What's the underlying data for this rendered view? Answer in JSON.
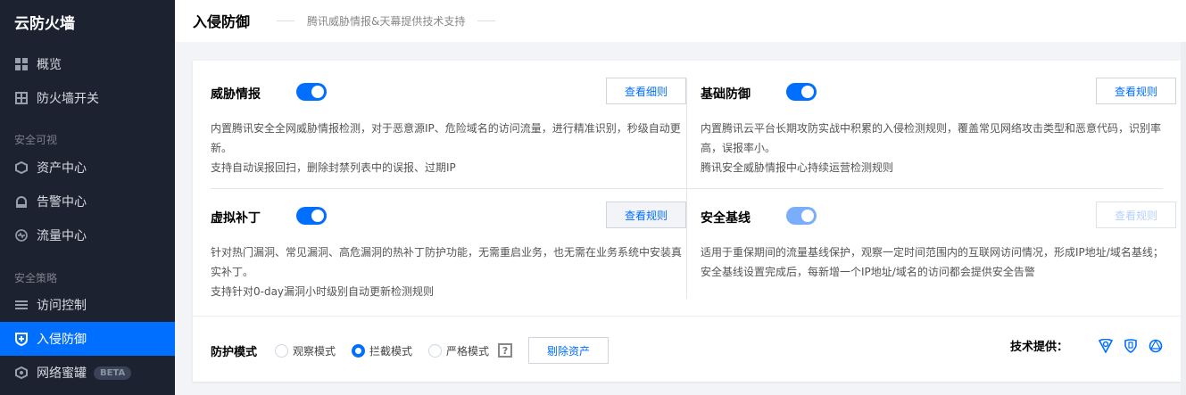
{
  "sidebar": {
    "title": "云防火墙",
    "items": [
      {
        "label": "概览",
        "icon": "grid-icon"
      },
      {
        "label": "防火墙开关",
        "icon": "table-icon"
      }
    ],
    "group1": "安全可视",
    "items2": [
      {
        "label": "资产中心",
        "icon": "cube-icon"
      },
      {
        "label": "告警中心",
        "icon": "alarm-icon"
      },
      {
        "label": "流量中心",
        "icon": "pulse-icon"
      }
    ],
    "group2": "安全策略",
    "items3": [
      {
        "label": "访问控制",
        "icon": "sliders-icon"
      },
      {
        "label": "入侵防御",
        "icon": "shield-plus-icon",
        "active": true
      },
      {
        "label": "网络蜜罐",
        "icon": "hexagon-icon",
        "badge": "BETA"
      }
    ]
  },
  "header": {
    "title": "入侵防御",
    "subtitle": "腾讯威胁情报&天幕提供技术支持"
  },
  "cells": [
    {
      "title": "威胁情报",
      "enabled": true,
      "button": "查看细则",
      "desc1": "内置腾讯安全全网威胁情报检测，对于恶意源IP、危险域名的访问流量，进行精准识别，秒级自动更新。",
      "desc2": "支持自动误报回扫，删除封禁列表中的误报、过期IP"
    },
    {
      "title": "基础防御",
      "enabled": true,
      "button": "查看规则",
      "desc1": "内置腾讯云平台长期攻防实战中积累的入侵检测规则，覆盖常见网络攻击类型和恶意代码，识别率高，误报率小。",
      "desc2": "腾讯安全威胁情报中心持续运营检测规则"
    },
    {
      "title": "虚拟补丁",
      "enabled": true,
      "button": "查看规则",
      "desc1": "针对热门漏洞、常见漏洞、高危漏洞的热补丁防护功能，无需重启业务，也无需在业务系统中安装真实补丁。",
      "desc2": "支持针对0-day漏洞小时级别自动更新检测规则"
    },
    {
      "title": "安全基线",
      "enabled": true,
      "button": "查看规则",
      "desc1": "适用于重保期间的流量基线保护，观察一定时间范围内的互联网访问情况，形成IP地址/域名基线；安全基线设置完成后，每新增一个IP地址/域名的访问都会提供安全告警",
      "desc2": ""
    }
  ],
  "footer": {
    "label": "防护模式",
    "modes": [
      "观察模式",
      "拦截模式",
      "严格模式"
    ],
    "selected": "拦截模式",
    "help": "?",
    "remove_button": "剔除资产",
    "tech_label": "技术提供："
  },
  "colors": {
    "accent": "#006eff",
    "sidebar": "#1d2230"
  }
}
